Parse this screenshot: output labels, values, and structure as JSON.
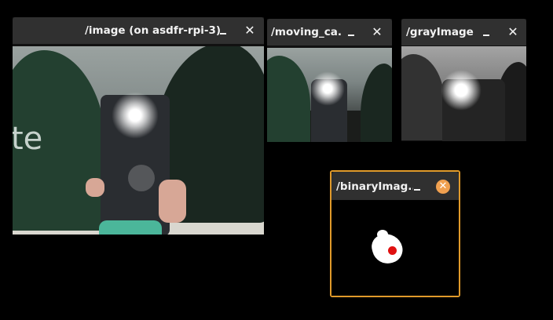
{
  "windows": [
    {
      "id": "image",
      "title": "/image (on asdfr-rpi-3)",
      "minimize_glyph": "",
      "close_glyph": "✕",
      "active": false,
      "logo_text": "te"
    },
    {
      "id": "moving_camera",
      "title": "/moving_ca...",
      "minimize_glyph": "",
      "close_glyph": "✕",
      "active": false
    },
    {
      "id": "grayImage",
      "title": "/grayImage (...",
      "minimize_glyph": "",
      "close_glyph": "✕",
      "active": false
    },
    {
      "id": "binaryImage",
      "title": "/binaryImag...",
      "minimize_glyph": "",
      "close_glyph": "✕",
      "active": true
    }
  ],
  "colors": {
    "titlebar": "#303030",
    "active_border": "#e09a2a",
    "active_close_bg": "#f0a050",
    "marker": "#e01010"
  },
  "icons": {
    "minimize": "minimize-icon",
    "close": "close-icon"
  }
}
